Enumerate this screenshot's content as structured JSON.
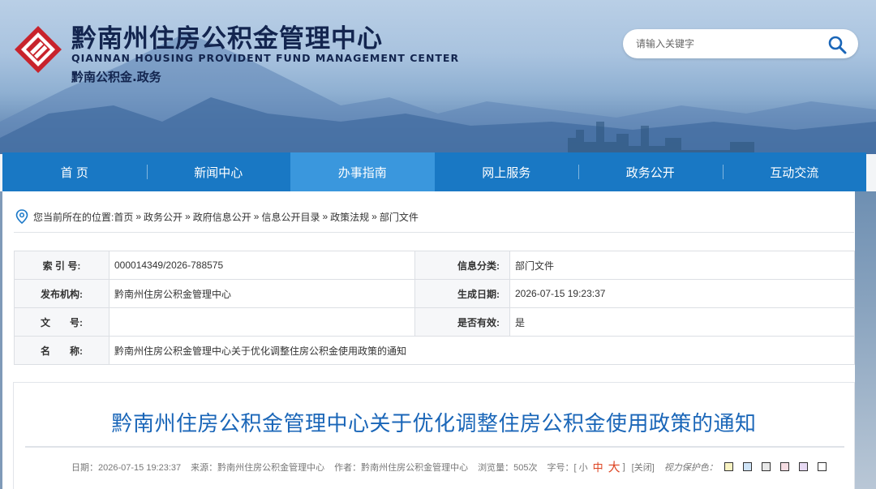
{
  "header": {
    "title_cn": "黔南州住房公积金管理中心",
    "title_en": "QIANNAN HOUSING PROVIDENT FUND MANAGEMENT CENTER",
    "subtitle": "黔南公积金.政务"
  },
  "search": {
    "placeholder": "请输入关键字",
    "icon": "search-icon"
  },
  "nav": {
    "items": [
      {
        "label": "首 页"
      },
      {
        "label": "新闻中心"
      },
      {
        "label": "办事指南",
        "active": true
      },
      {
        "label": "网上服务"
      },
      {
        "label": "政务公开"
      },
      {
        "label": "互动交流"
      }
    ]
  },
  "breadcrumb": {
    "prefix": "您当前所在的位置:",
    "items": [
      "首页",
      "政务公开",
      "政府信息公开",
      "信息公开目录",
      "政策法规",
      "部门文件"
    ],
    "separator": "»"
  },
  "info_table": {
    "index_label": "索 引 号:",
    "index_value": "000014349/2026-788575",
    "category_label": "信息分类:",
    "category_value": "部门文件",
    "publisher_label": "发布机构:",
    "publisher_value": "黔南州住房公积金管理中心",
    "date_label": "生成日期:",
    "date_value": "2026-07-15 19:23:37",
    "docno_label": "文　　号:",
    "docno_value": "",
    "valid_label": "是否有效:",
    "valid_value": "是",
    "name_label": "名　　称:",
    "name_value": "黔南州住房公积金管理中心关于优化调整住房公积金使用政策的通知"
  },
  "article": {
    "title": "黔南州住房公积金管理中心关于优化调整住房公积金使用政策的通知",
    "meta": {
      "date": "日期：2026-07-15 19:23:37",
      "source": "来源：黔南州住房公积金管理中心",
      "author": "作者：黔南州住房公积金管理中心",
      "views": "浏览量：505次",
      "font_size_label": "字号：[",
      "font_small": "小",
      "font_medium": "中",
      "font_large": "大",
      "font_close": "]",
      "close": "[关闭]",
      "eye_protect": "视力保护色："
    },
    "swatch_colors": [
      "#f9f3c2",
      "#cfe4f7",
      "#e8e8e8",
      "#f6dde3",
      "#e7d9f3",
      "#ffffff"
    ]
  },
  "colors": {
    "nav_bg": "#1978c4",
    "nav_active": "#3a97dd",
    "title_blue": "#1a66b8",
    "logo_red": "#c8232c"
  }
}
